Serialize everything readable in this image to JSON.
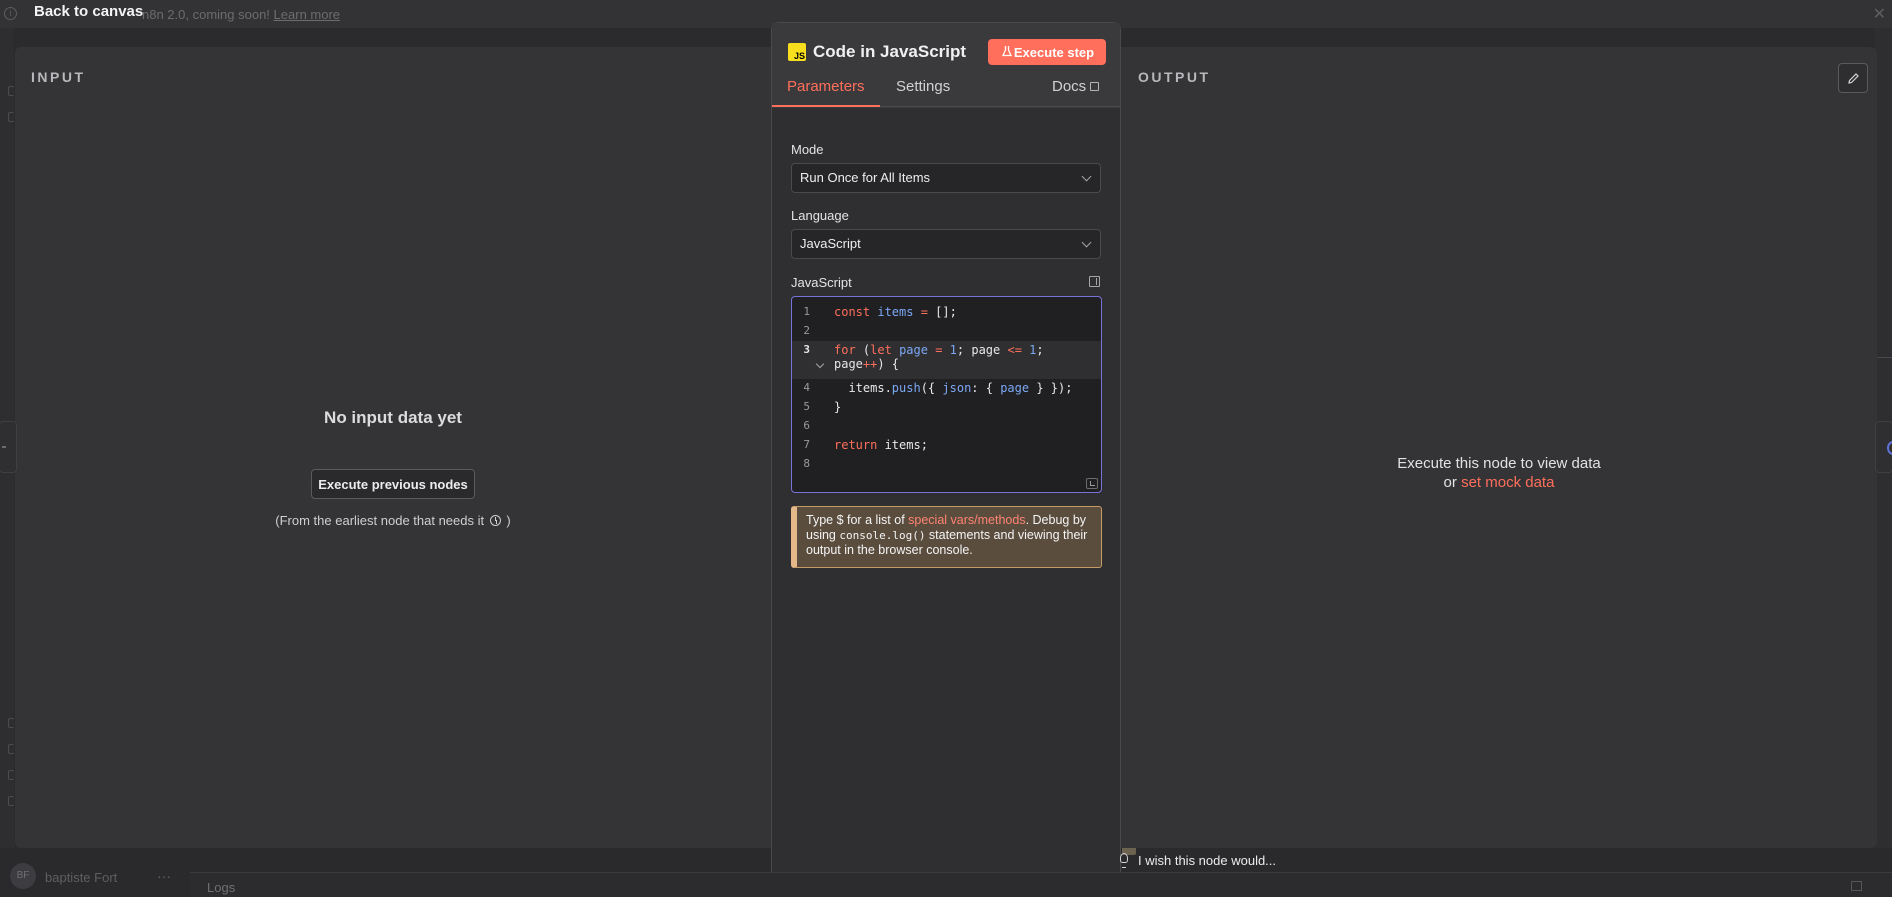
{
  "banner": {
    "message_prefix": "n8n 2.0, coming soon!",
    "learn_more": "Learn more",
    "info_icon": "info-icon",
    "close_icon": "close-icon"
  },
  "nav": {
    "back_label": "Back to canvas"
  },
  "input_panel": {
    "title": "INPUT",
    "empty_title": "No input data yet",
    "execute_previous_label": "Execute previous nodes",
    "note_prefix": "(From the earliest node that needs it",
    "note_suffix": ")"
  },
  "node": {
    "badge": "JS",
    "title": "Code in JavaScript",
    "execute_step_label": "Execute step",
    "tabs": {
      "parameters": "Parameters",
      "settings": "Settings",
      "docs": "Docs"
    },
    "mode_label": "Mode",
    "mode_value": "Run Once for All Items",
    "language_label": "Language",
    "language_value": "JavaScript",
    "code_label": "JavaScript",
    "code_lines": [
      {
        "n": "1",
        "text": "const items = [];"
      },
      {
        "n": "2",
        "text": ""
      },
      {
        "n": "3",
        "text": "for (let page = 1; page <= 1; page++) {"
      },
      {
        "n": "4",
        "text": "  items.push({ json: { page } });"
      },
      {
        "n": "5",
        "text": "}"
      },
      {
        "n": "6",
        "text": ""
      },
      {
        "n": "7",
        "text": "return items;"
      },
      {
        "n": "8",
        "text": ""
      }
    ],
    "hint": {
      "t1": "Type ",
      "dollar": "$",
      "t2": " for a list of ",
      "link": "special vars/methods",
      "t3": ". Debug by using ",
      "code": "console.log()",
      "t4": " statements and viewing their output in the browser console."
    }
  },
  "output_panel": {
    "title": "OUTPUT",
    "line1": "Execute this node to view data",
    "line2_prefix": "or",
    "mock_link": "set mock data"
  },
  "footer": {
    "avatar_initials": "BF",
    "username": "baptiste Fort",
    "more": "···",
    "logs_label": "Logs",
    "wish_text": "I wish this node would..."
  },
  "colors": {
    "accent": "#ff6f5c",
    "focus_border": "#7773d9",
    "hint_border": "#e5b889"
  }
}
